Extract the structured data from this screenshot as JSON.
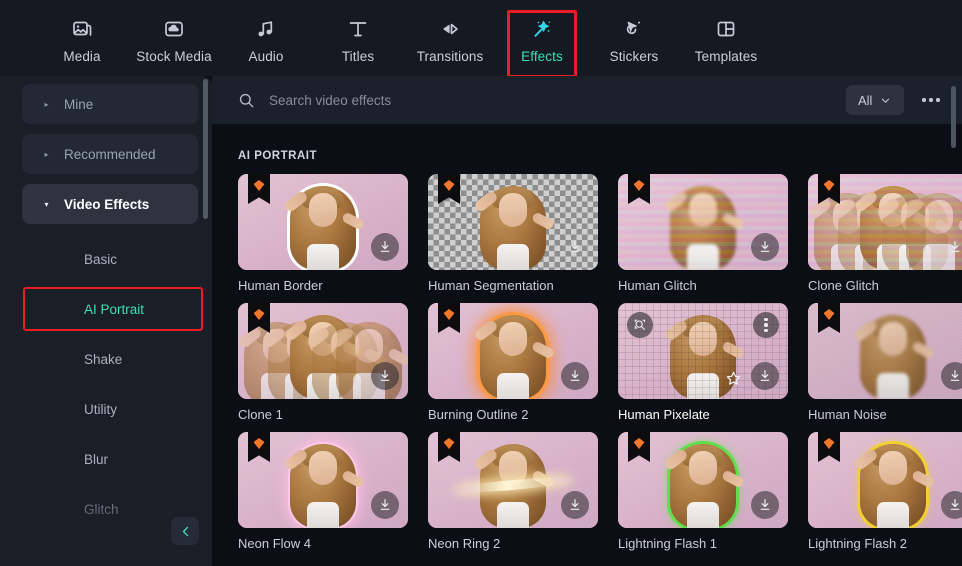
{
  "app": {
    "accent_teal": "#3ddfb5",
    "accent_cyan": "#2fd6e8",
    "highlight_red": "#ec1c24",
    "topbar_bg": "#141922",
    "sidebar_bg": "#191e27",
    "panel_bg": "#0b0e14",
    "premium_orange": "#f2772c"
  },
  "topbar": {
    "tabs": [
      {
        "label": "Media",
        "icon": "media-image-icon"
      },
      {
        "label": "Stock Media",
        "icon": "stock-media-cloud-icon"
      },
      {
        "label": "Audio",
        "icon": "audio-note-icon"
      },
      {
        "label": "Titles",
        "icon": "titles-text-icon"
      },
      {
        "label": "Transitions",
        "icon": "transitions-arrows-icon"
      },
      {
        "label": "Effects",
        "icon": "effects-magic-wand-icon"
      },
      {
        "label": "Stickers",
        "icon": "stickers-cursor-icon"
      },
      {
        "label": "Templates",
        "icon": "templates-layout-icon"
      }
    ],
    "active_tab": "Effects"
  },
  "sidebar": {
    "groups": [
      {
        "label": "Mine",
        "expanded": false
      },
      {
        "label": "Recommended",
        "expanded": false
      },
      {
        "label": "Video Effects",
        "expanded": true
      }
    ],
    "subitems": [
      {
        "label": "Basic",
        "selected": false,
        "dim": false
      },
      {
        "label": "AI Portrait",
        "selected": true,
        "dim": false
      },
      {
        "label": "Shake",
        "selected": false,
        "dim": false
      },
      {
        "label": "Utility",
        "selected": false,
        "dim": false
      },
      {
        "label": "Blur",
        "selected": false,
        "dim": false
      },
      {
        "label": "Glitch",
        "selected": false,
        "dim": true
      }
    ],
    "collapse_button": "collapse-panel-chevron"
  },
  "search": {
    "placeholder": "Search video effects",
    "value": "",
    "icon": "search-icon"
  },
  "filter": {
    "selected": "All",
    "caret": "chevron-down-icon"
  },
  "more_menu": {
    "label": "more-options"
  },
  "main": {
    "section_title": "AI PORTRAIT",
    "cards": [
      {
        "name": "Human Border",
        "premium": true,
        "style": "border",
        "bg": "pink",
        "downloadable": true,
        "hovered": false
      },
      {
        "name": "Human Segmentation",
        "premium": true,
        "style": "segmentation",
        "bg": "checker",
        "downloadable": true,
        "hovered": false
      },
      {
        "name": "Human Glitch",
        "premium": true,
        "style": "glitch",
        "bg": "pink",
        "downloadable": true,
        "hovered": false
      },
      {
        "name": "Clone Glitch",
        "premium": true,
        "style": "clone-glitch",
        "bg": "pink",
        "downloadable": true,
        "hovered": false
      },
      {
        "name": "Clone 1",
        "premium": true,
        "style": "clone",
        "bg": "pink",
        "downloadable": true,
        "hovered": false
      },
      {
        "name": "Burning Outline 2",
        "premium": true,
        "style": "glow-orange",
        "bg": "pink",
        "downloadable": true,
        "hovered": false
      },
      {
        "name": "Human Pixelate",
        "premium": false,
        "style": "pixelate",
        "bg": "pink",
        "downloadable": true,
        "hovered": true
      },
      {
        "name": "Human Noise",
        "premium": true,
        "style": "noise",
        "bg": "pink",
        "downloadable": true,
        "hovered": false
      },
      {
        "name": "Neon Flow 4",
        "premium": true,
        "style": "glow-pink",
        "bg": "pink",
        "downloadable": true,
        "hovered": false
      },
      {
        "name": "Neon Ring 2",
        "premium": true,
        "style": "ring",
        "bg": "pink",
        "downloadable": true,
        "hovered": false
      },
      {
        "name": "Lightning Flash 1",
        "premium": true,
        "style": "glow-green",
        "bg": "pink",
        "downloadable": true,
        "hovered": false
      },
      {
        "name": "Lightning Flash 2",
        "premium": true,
        "style": "glow-yellow",
        "bg": "pink",
        "downloadable": true,
        "hovered": false
      }
    ],
    "hover_card_controls": {
      "preview": "preview-zoom-icon",
      "menu": "kebab-menu-icon",
      "favorite": "star-favorite-icon",
      "download": "download-icon"
    }
  }
}
